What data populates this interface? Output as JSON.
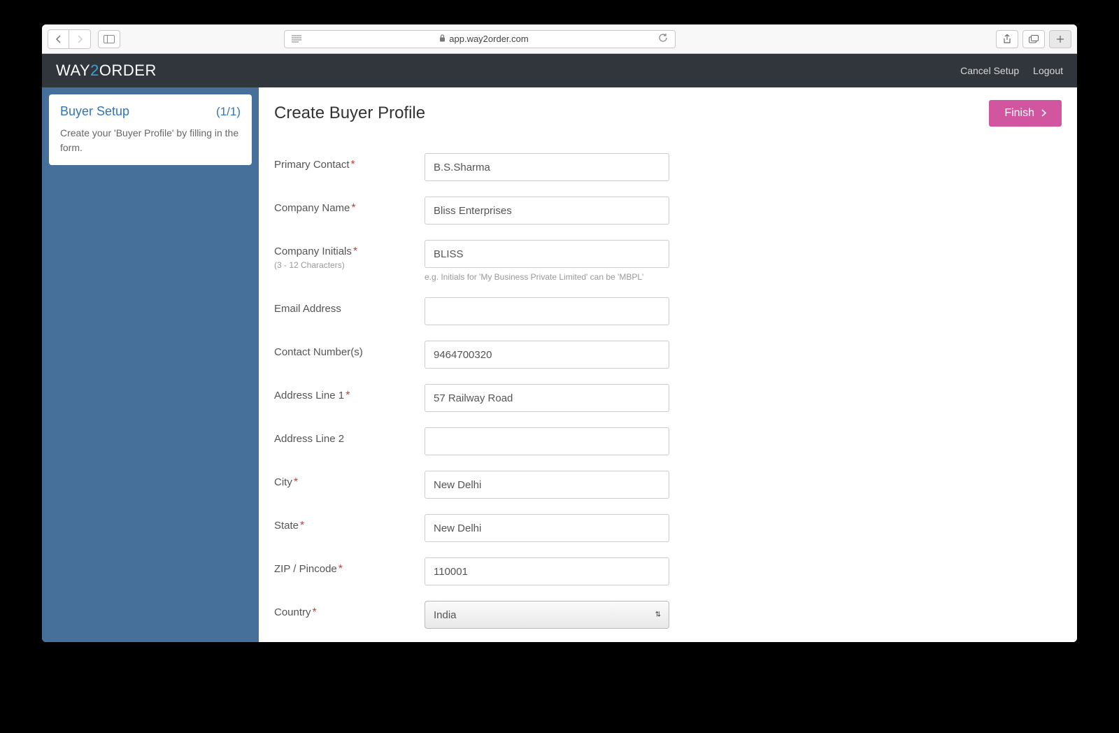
{
  "browser": {
    "url": "app.way2order.com"
  },
  "logo": {
    "part1": "WAY",
    "part2": "2",
    "part3": "ORDER"
  },
  "header_links": {
    "cancel": "Cancel Setup",
    "logout": "Logout"
  },
  "sidebar": {
    "title": "Buyer Setup",
    "count": "(1/1)",
    "description": "Create your 'Buyer Profile' by filling in the form."
  },
  "page": {
    "title": "Create Buyer Profile",
    "finish_label": "Finish"
  },
  "form": {
    "primary_contact": {
      "label": "Primary Contact",
      "value": "B.S.Sharma"
    },
    "company_name": {
      "label": "Company Name",
      "value": "Bliss Enterprises"
    },
    "company_initials": {
      "label": "Company Initials",
      "hint": "(3 - 12 Characters)",
      "value": "BLISS",
      "help": "e.g. Initials for 'My Business Private Limited' can be 'MBPL'"
    },
    "email": {
      "label": "Email Address",
      "value": ""
    },
    "contact_numbers": {
      "label": "Contact Number(s)",
      "value": "9464700320"
    },
    "address1": {
      "label": "Address Line 1",
      "value": "57 Railway Road"
    },
    "address2": {
      "label": "Address Line 2",
      "value": ""
    },
    "city": {
      "label": "City",
      "value": "New Delhi"
    },
    "state": {
      "label": "State",
      "value": "New Delhi"
    },
    "zip": {
      "label": "ZIP / Pincode",
      "value": "110001"
    },
    "country": {
      "label": "Country",
      "value": "India"
    }
  }
}
